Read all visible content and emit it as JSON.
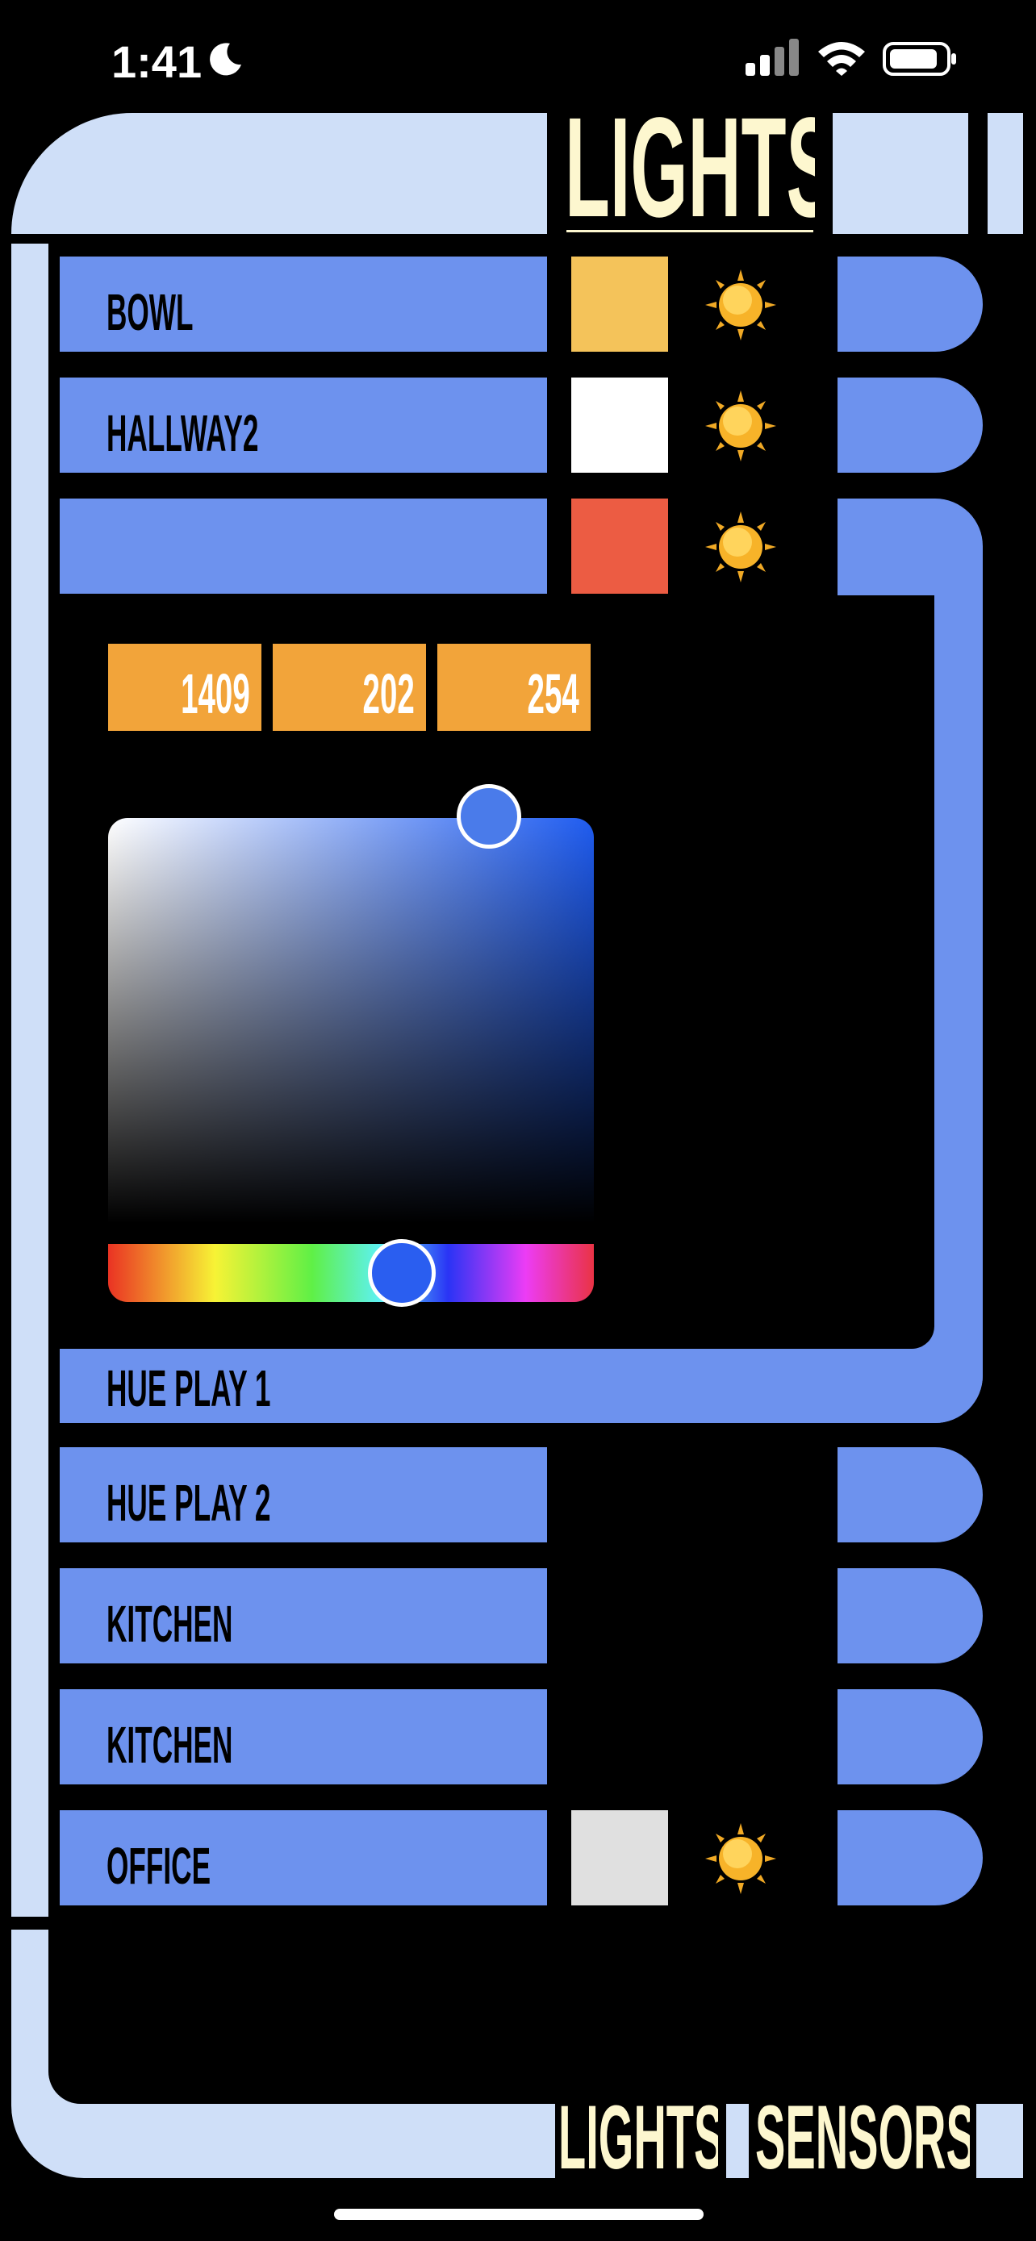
{
  "status_bar": {
    "time": "1:41"
  },
  "header": {
    "title": "LIGHTS"
  },
  "lights": [
    {
      "name": "BOWL",
      "color": "#f4c35a",
      "has_toggle": true
    },
    {
      "name": "HALLWAY2",
      "color": "#ffffff",
      "has_toggle": true
    },
    {
      "name": "",
      "color": "#ec5c43",
      "has_toggle": true,
      "expanded": true
    },
    {
      "name": "HUE PLAY 1"
    },
    {
      "name": "HUE PLAY 2"
    },
    {
      "name": "KITCHEN"
    },
    {
      "name": "KITCHEN"
    },
    {
      "name": "OFFICE",
      "color": "#e0e0e0",
      "has_toggle": true
    }
  ],
  "color_picker": {
    "values": [
      "1409",
      "202",
      "254"
    ],
    "selected_color": "#3f73ea",
    "hue_fraction": 0.61
  },
  "bottom_nav": {
    "lights_label": "LIGHTS",
    "sensors_label": "SENSORS"
  },
  "colors": {
    "accent_blue": "#6d92ee",
    "frame": "#cfdff8",
    "title_yellow": "#fdf7cf",
    "number_orange": "#f2a43a"
  },
  "icons": [
    "moon-icon",
    "signal-icon",
    "wifi-icon",
    "battery-icon",
    "sun-icon"
  ]
}
